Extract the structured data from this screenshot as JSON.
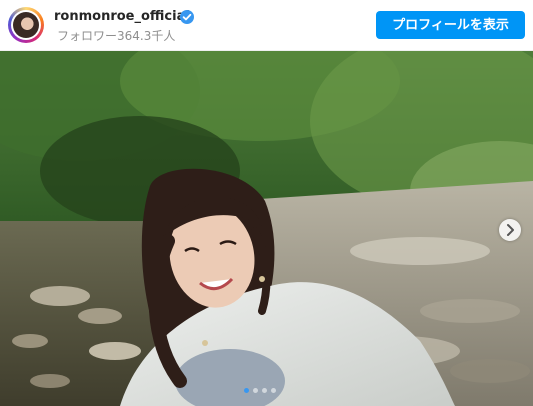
{
  "post_header": {
    "username": "ronmonroe_official",
    "verified_icon": "verified-badge-icon",
    "followers_text": "フォロワー364.3千人",
    "profile_button_label": "プロフィールを表示"
  },
  "photo": {
    "subject": "smiling woman sitting on river rocks in a forest",
    "next_icon": "chevron-right-icon"
  },
  "carousel": {
    "dot_count": 4,
    "active_index": 0
  },
  "colors": {
    "accent": "#0095f6",
    "verified": "#3897f0"
  }
}
